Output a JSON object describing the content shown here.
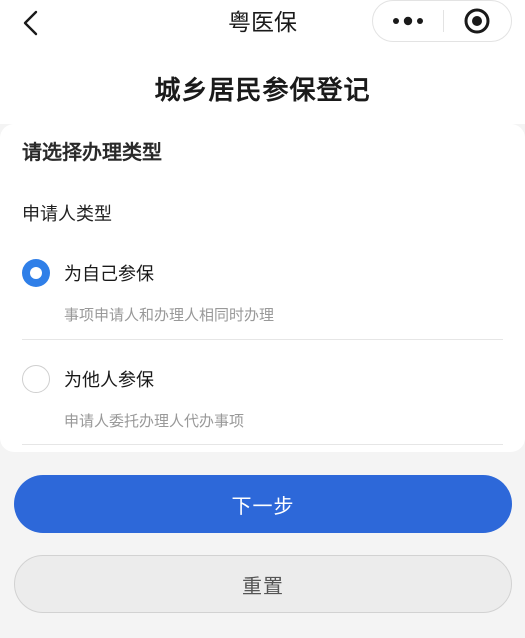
{
  "topbar": {
    "app_title": "粤医保",
    "back_icon": "chevron-left-icon",
    "more_icon": "more-dots-icon",
    "close_icon": "close-circle-icon"
  },
  "page": {
    "title": "城乡居民参保登记"
  },
  "form": {
    "section_title": "请选择办理类型",
    "field_label": "申请人类型",
    "options": [
      {
        "label": "为自己参保",
        "description": "事项申请人和办理人相同时办理",
        "checked": true
      },
      {
        "label": "为他人参保",
        "description": "申请人委托办理人代办事项",
        "checked": false
      }
    ]
  },
  "actions": {
    "next_label": "下一步",
    "reset_label": "重置"
  },
  "colors": {
    "primary": "#2d68d9",
    "radio_checked": "#2f7fe8",
    "secondary_bg": "#ececec",
    "desc_text": "#999999"
  }
}
